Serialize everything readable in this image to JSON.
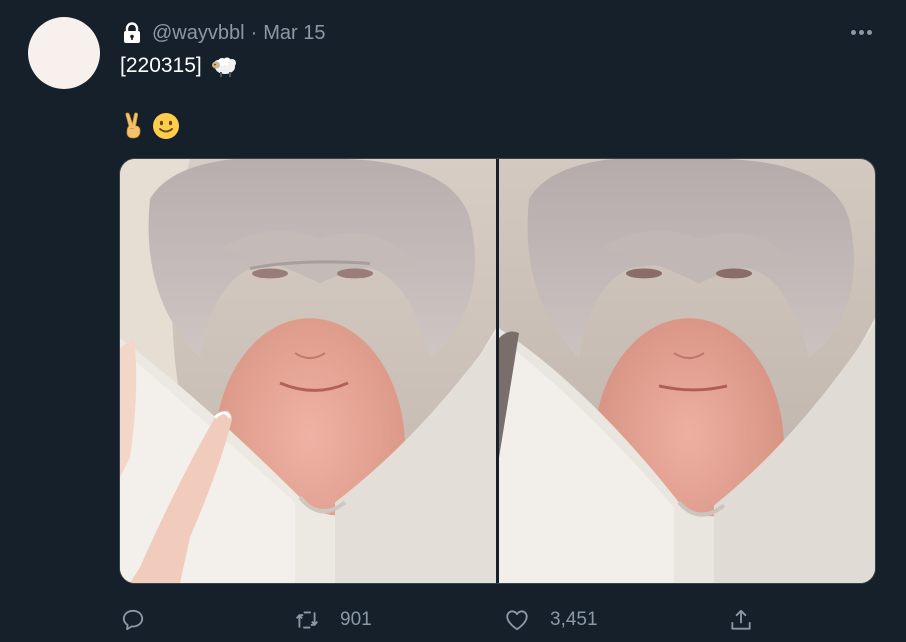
{
  "tweet": {
    "handle": "@wayvbbl",
    "separator": "·",
    "date": "Mar 15",
    "text": "[220315]",
    "more_label": "More",
    "emoji_icons": [
      "victory-hand-icon",
      "slightly-smiling-face-icon"
    ],
    "inline_icon": "ram-icon",
    "account_icon": "lock-icon"
  },
  "media": {
    "photos": [
      {
        "alt": "Image"
      },
      {
        "alt": "Image"
      }
    ]
  },
  "actions": {
    "reply": {
      "icon": "reply-icon",
      "count": ""
    },
    "retweet": {
      "icon": "retweet-icon",
      "count": "901"
    },
    "like": {
      "icon": "heart-icon",
      "count": "3,451"
    },
    "share": {
      "icon": "share-icon"
    }
  },
  "colors": {
    "background": "#15202b",
    "text_primary": "#ffffff",
    "text_secondary": "#8b98a5",
    "border": "#38444d",
    "avatar": "#f8f0ec"
  }
}
